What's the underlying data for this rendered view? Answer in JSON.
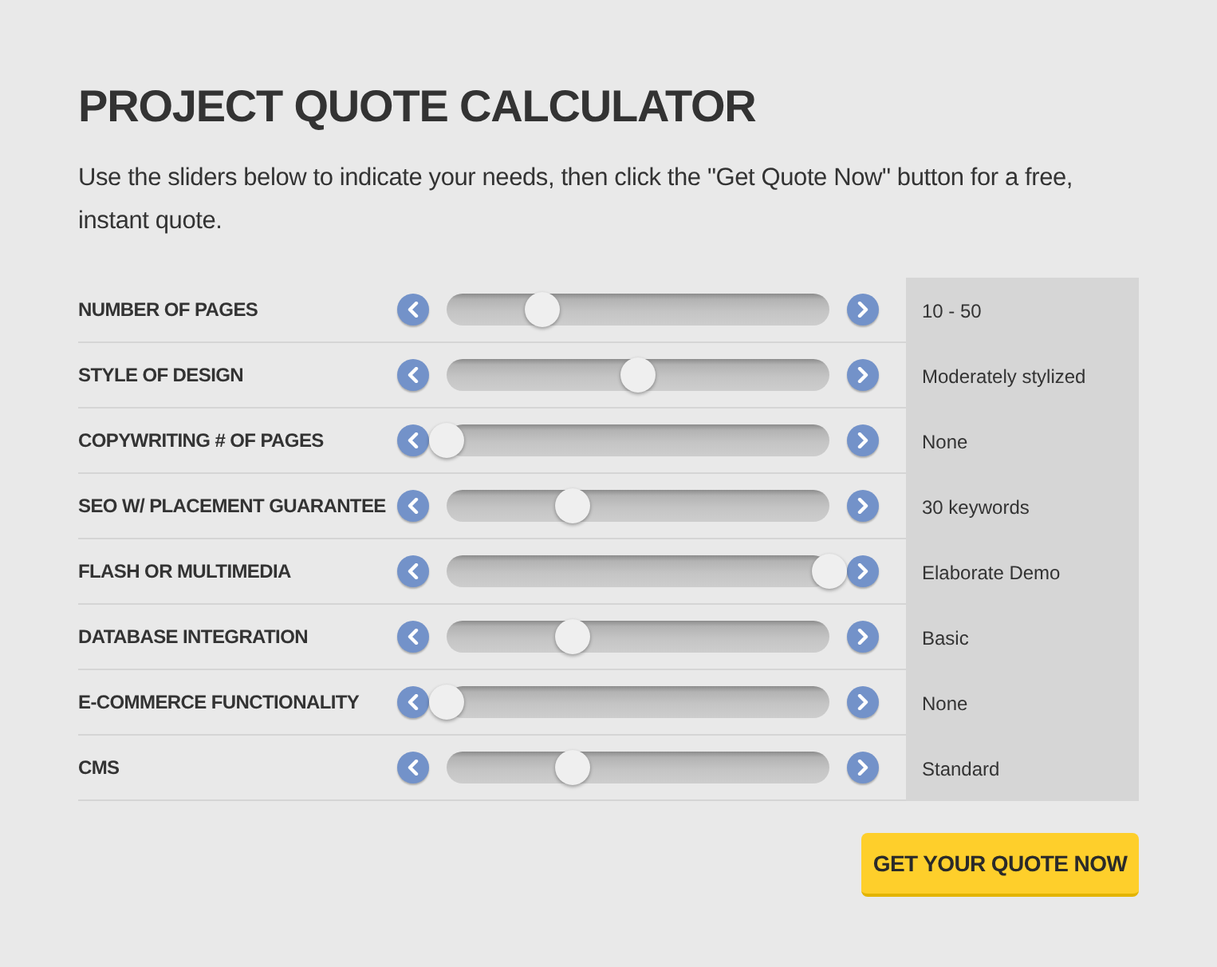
{
  "title": "PROJECT QUOTE CALCULATOR",
  "intro": "Use the sliders below to indicate your needs, then click the \"Get Quote Now\" button for a free, instant quote.",
  "sliders": [
    {
      "label": "NUMBER OF PAGES",
      "level": 0.25,
      "reading": "10 - 50"
    },
    {
      "label": "STYLE OF DESIGN",
      "level": 0.5,
      "reading": "Moderately stylized"
    },
    {
      "label": "COPYWRITING # OF PAGES",
      "level": 0,
      "reading": "None"
    },
    {
      "label": "SEO W/ PLACEMENT GUARANTEE",
      "level": 0.33,
      "reading": "30 keywords"
    },
    {
      "label": "FLASH OR MULTIMEDIA",
      "level": 1,
      "reading": "Elaborate Demo"
    },
    {
      "label": "DATABASE INTEGRATION",
      "level": 0.33,
      "reading": "Basic"
    },
    {
      "label": "E-COMMERCE FUNCTIONALITY",
      "level": 0,
      "reading": "None"
    },
    {
      "label": "CMS",
      "level": 0.33,
      "reading": "Standard"
    }
  ],
  "button": "GET YOUR QUOTE NOW"
}
